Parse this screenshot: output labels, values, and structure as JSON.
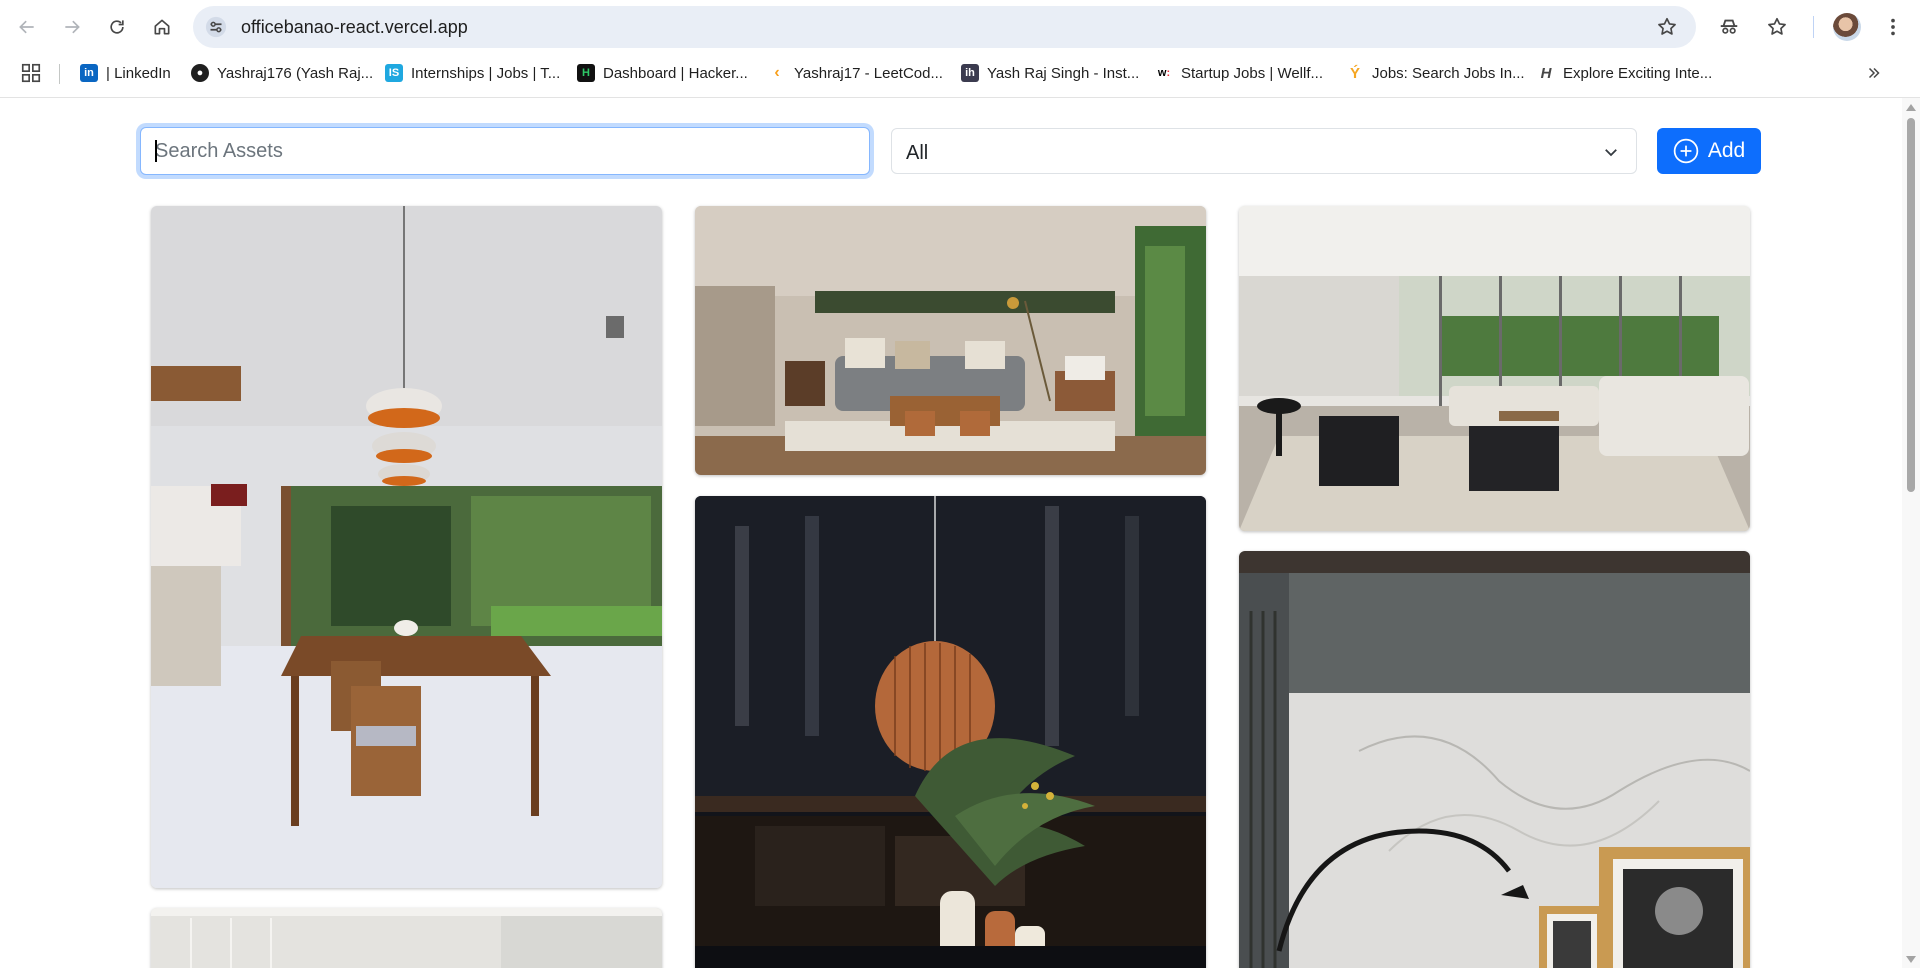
{
  "browser": {
    "url": "officebanao-react.vercel.app",
    "bookmarks": [
      {
        "label": "| LinkedIn",
        "icon": "linkedin-icon",
        "color": "#0a66c2",
        "glyph": "in"
      },
      {
        "label": "Yashraj176 (Yash Raj...",
        "icon": "github-icon",
        "color": "#1f1f1f",
        "glyph": ""
      },
      {
        "label": "Internships | Jobs | T...",
        "icon": "internshala-icon",
        "color": "#1fa8e0",
        "glyph": "IS"
      },
      {
        "label": "Dashboard | Hacker...",
        "icon": "hackerrank-icon",
        "color": "#111111",
        "glyph": "H"
      },
      {
        "label": "Yashraj17 - LeetCod...",
        "icon": "leetcode-icon",
        "color": "#ffffff",
        "glyph": ""
      },
      {
        "label": "Yash Raj Singh - Inst...",
        "icon": "instahyre-icon",
        "color": "#3b3b4f",
        "glyph": "ih"
      },
      {
        "label": "Startup Jobs | Wellf...",
        "icon": "wellfound-icon",
        "color": "#ffffff",
        "glyph": "w:"
      },
      {
        "label": "Jobs: Search Jobs In...",
        "icon": "naukri-icon",
        "color": "#ffffff",
        "glyph": ""
      },
      {
        "label": "Explore Exciting Inte...",
        "icon": "hirect-icon",
        "color": "#ffffff",
        "glyph": "H"
      }
    ]
  },
  "page": {
    "search": {
      "placeholder": "Search Assets",
      "value": ""
    },
    "filter": {
      "selected": "All"
    },
    "add_button": {
      "label": "Add"
    },
    "colors": {
      "primary": "#0d6efd",
      "focus_border": "#86b7fe"
    },
    "assets": [
      {
        "name": "dining-room-photo"
      },
      {
        "name": "living-room-photo"
      },
      {
        "name": "open-lounge-photo"
      },
      {
        "name": "dark-kitchen-pendant-photo"
      },
      {
        "name": "marble-wall-lamp-photo"
      },
      {
        "name": "bright-room-photo"
      }
    ]
  }
}
